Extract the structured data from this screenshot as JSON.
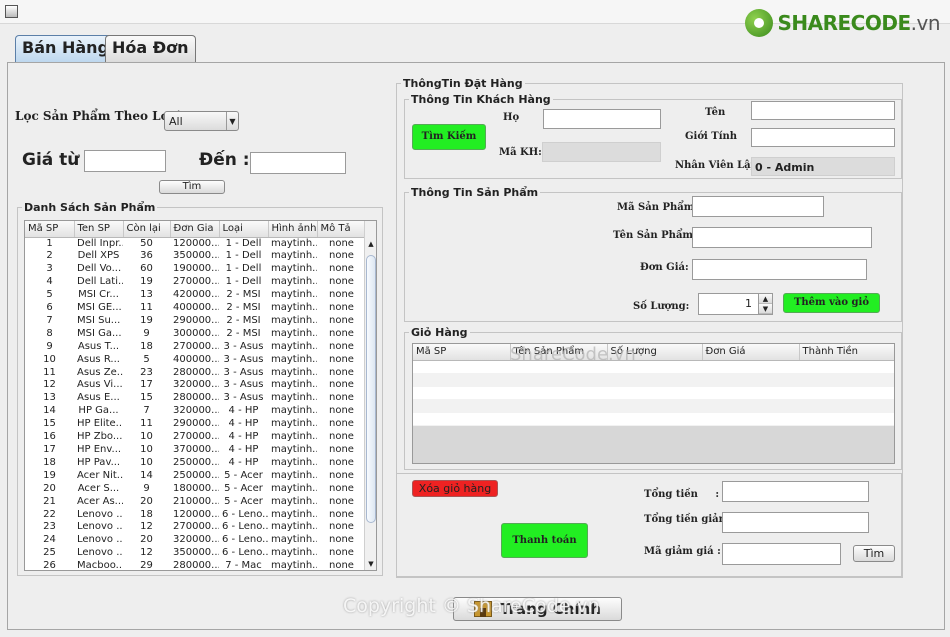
{
  "logo": {
    "brand": "SHARECODE",
    "tld": ".vn"
  },
  "tabs": [
    {
      "label": "Bán Hàng",
      "active": true
    },
    {
      "label": "Hóa Đơn",
      "active": false
    }
  ],
  "filter": {
    "category_label": "Lọc Sản Phẩm Theo Loại:",
    "category_value": "All",
    "price_from_label": "Giá từ :",
    "price_to_label": "Đến :",
    "search_button": "Tìm"
  },
  "product_list": {
    "title": "Danh Sách Sản Phẩm",
    "columns": [
      "Mã SP",
      "Ten SP",
      "Còn lại",
      "Đơn Gia",
      "Loại",
      "Hình ảnh",
      "Mô Tả"
    ],
    "rows": [
      [
        "1",
        "Dell Inpr...",
        "50",
        "120000...",
        "1 - Dell",
        "maytinh...",
        "none"
      ],
      [
        "2",
        "Dell XPS",
        "36",
        "350000...",
        "1 - Dell",
        "maytinh...",
        "none"
      ],
      [
        "3",
        "Dell Vo...",
        "60",
        "190000...",
        "1 - Dell",
        "maytinh...",
        "none"
      ],
      [
        "4",
        "Dell Lati...",
        "19",
        "270000...",
        "1 - Dell",
        "maytinh...",
        "none"
      ],
      [
        "5",
        "MSI Cr...",
        "13",
        "420000...",
        "2 - MSI",
        "maytinh...",
        "none"
      ],
      [
        "6",
        "MSI GE...",
        "11",
        "400000...",
        "2 - MSI",
        "maytinh...",
        "none"
      ],
      [
        "7",
        "MSI Su...",
        "19",
        "290000...",
        "2 - MSI",
        "maytinh...",
        "none"
      ],
      [
        "8",
        "MSI Ga...",
        "9",
        "300000...",
        "2 - MSI",
        "maytinh...",
        "none"
      ],
      [
        "9",
        "Asus T...",
        "18",
        "270000...",
        "3 - Asus",
        "maytinh...",
        "none"
      ],
      [
        "10",
        "Asus R...",
        "5",
        "400000...",
        "3 - Asus",
        "maytinh...",
        "none"
      ],
      [
        "11",
        "Asus Ze...",
        "23",
        "280000...",
        "3 - Asus",
        "maytinh...",
        "none"
      ],
      [
        "12",
        "Asus Vi...",
        "17",
        "320000...",
        "3 - Asus",
        "maytinh...",
        "none"
      ],
      [
        "13",
        "Asus E...",
        "15",
        "280000...",
        "3 - Asus",
        "maytinh...",
        "none"
      ],
      [
        "14",
        "HP Ga...",
        "7",
        "320000...",
        "4 - HP",
        "maytinh...",
        "none"
      ],
      [
        "15",
        "HP Elite...",
        "11",
        "290000...",
        "4 - HP",
        "maytinh...",
        "none"
      ],
      [
        "16",
        "HP Zbo...",
        "10",
        "270000...",
        "4 - HP",
        "maytinh...",
        "none"
      ],
      [
        "17",
        "HP Env...",
        "10",
        "370000...",
        "4 - HP",
        "maytinh...",
        "none"
      ],
      [
        "18",
        "HP Pav...",
        "10",
        "250000...",
        "4 - HP",
        "maytinh...",
        "none"
      ],
      [
        "19",
        "Acer Nit...",
        "14",
        "250000...",
        "5 - Acer",
        "maytinh...",
        "none"
      ],
      [
        "20",
        "Acer S...",
        "9",
        "180000...",
        "5 - Acer",
        "maytinh...",
        "none"
      ],
      [
        "21",
        "Acer As...",
        "20",
        "210000...",
        "5 - Acer",
        "maytinh...",
        "none"
      ],
      [
        "22",
        "Lenovo ...",
        "18",
        "120000...",
        "6 - Leno...",
        "maytinh...",
        "none"
      ],
      [
        "23",
        "Lenovo ...",
        "12",
        "270000...",
        "6 - Leno...",
        "maytinh...",
        "none"
      ],
      [
        "24",
        "Lenovo ...",
        "20",
        "320000...",
        "6 - Leno...",
        "maytinh...",
        "none"
      ],
      [
        "25",
        "Lenovo ...",
        "12",
        "350000...",
        "6 - Leno...",
        "maytinh...",
        "none"
      ],
      [
        "26",
        "Macboo...",
        "29",
        "280000...",
        "7 - Mac",
        "maytinh...",
        "none"
      ]
    ]
  },
  "order_info": {
    "title": "ThôngTin Đặt Hàng",
    "customer": {
      "title": "Thông Tin Khách Hàng",
      "search_button": "Tìm Kiếm",
      "last_name_label": "Họ",
      "first_name_label": "Tên",
      "gender_label": "Giới Tính",
      "customer_id_label": "Mã KH:",
      "staff_label": "Nhân Viên Lập",
      "staff_value": "0 - Admin"
    },
    "product": {
      "title": "Thông Tin Sản Phẩm",
      "product_id_label": "Mã Sản Phẩm:",
      "product_name_label": "Tên Sản Phẩm:",
      "unit_price_label": "Đơn Giá:",
      "quantity_label": "Số Lượng:",
      "quantity_value": "1",
      "add_to_cart_button": "Thêm vào giỏ"
    },
    "cart": {
      "title": "Giỏ Hàng",
      "columns": [
        "Mã SP",
        "Tên Sản Phẩm",
        "Số Lượng",
        "Đơn Giá",
        "Thành Tiền"
      ],
      "clear_button": "Xóa giỏ hàng"
    },
    "totals": {
      "total_label": "Tổng tiền     :",
      "discount_total_label": "Tổng tiền giảm :",
      "coupon_label": "Mã giảm giá :",
      "coupon_search_button": "Tìm",
      "pay_button": "Thanh toán"
    }
  },
  "footer": {
    "home_button": "Trang Chính",
    "copyright": "Copyright © ShareCode.vn",
    "watermark": "ShareCode.vn"
  }
}
